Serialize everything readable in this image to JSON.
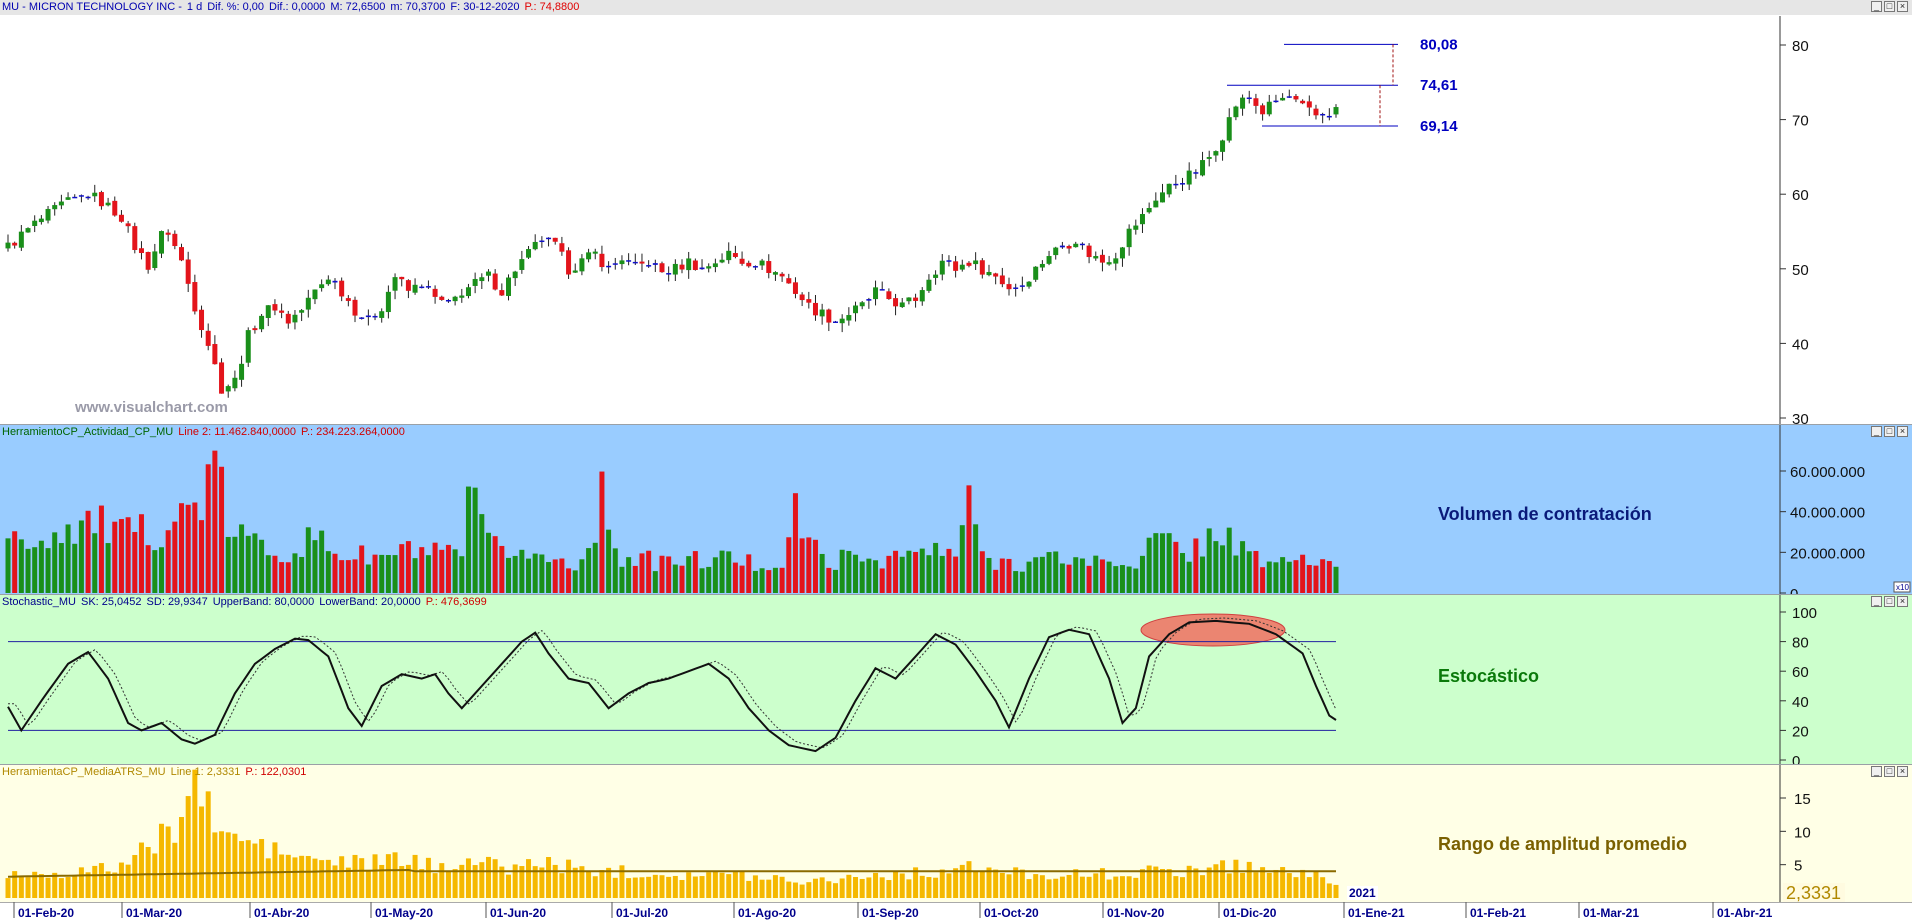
{
  "colors": {
    "up": "#1a8f1a",
    "down": "#e3141b",
    "doji": "#1010c8",
    "vol_bg": "#99ccff",
    "stoch_bg": "#ccffcc",
    "atr_bg": "#ffffe6",
    "atr_bar": "#f5b800",
    "level_line": "#0000c0"
  },
  "price_panel": {
    "header": {
      "symbol": "MU - MICRON TECHNOLOGY INC -",
      "timeframe": "1 d",
      "dif_pct": "Dif. %: 0,00",
      "dif": "Dif.: 0,0000",
      "max": "M: 72,6500",
      "min": "m: 70,3700",
      "date": "F: 30-12-2020",
      "price": "P.: 74,8800"
    },
    "watermark": "www.visualchart.com",
    "y_ticks": [
      "30",
      "40",
      "50",
      "60",
      "70",
      "80"
    ],
    "levels": [
      {
        "value": 80.08,
        "label": "80,08"
      },
      {
        "value": 74.61,
        "label": "74,61"
      },
      {
        "value": 69.14,
        "label": "69,14"
      }
    ]
  },
  "volume_panel": {
    "header": {
      "name": "HerramientoCP_Actividad_CP_MU",
      "line": "Line 2: 11.462.840,0000",
      "price": "P.: 234.223.264,0000"
    },
    "title": "Volumen de contratación",
    "y_ticks": [
      "0",
      "20.000.000",
      "40.000.000",
      "60.000.000"
    ],
    "scale_badge": "x10"
  },
  "stoch_panel": {
    "header": {
      "name": "Stochastic_MU",
      "sk": "SK: 25,0452",
      "sd": "SD: 29,9347",
      "upper": "UpperBand: 80,0000",
      "lower": "LowerBand: 20,0000",
      "price": "P.: 476,3699"
    },
    "title": "Estocástico",
    "y_ticks": [
      "0",
      "20",
      "40",
      "60",
      "80",
      "100"
    ]
  },
  "atr_panel": {
    "header": {
      "name": "HerramientaCP_MediaATRS_MU",
      "line": "Line 1: 2,3331",
      "price": "P.: 122,0301"
    },
    "title": "Rango de amplitud promedio",
    "y_ticks": [
      "5",
      "10",
      "15"
    ],
    "last_value": "2,3331"
  },
  "x_axis": {
    "labels": [
      "01-Feb-20",
      "01-Mar-20",
      "01-Abr-20",
      "01-May-20",
      "01-Jun-20",
      "01-Jul-20",
      "01-Ago-20",
      "01-Sep-20",
      "01-Oct-20",
      "01-Nov-20",
      "01-Dic-20",
      "01-Ene-21",
      "01-Feb-21",
      "01-Mar-21",
      "01-Abr-21"
    ],
    "year_marker": "2021"
  },
  "chart_data": {
    "type": "line",
    "title": "",
    "price_anchors": [
      [
        0,
        53
      ],
      [
        4,
        56
      ],
      [
        8,
        58.5
      ],
      [
        12,
        60
      ],
      [
        14,
        59
      ],
      [
        17,
        57
      ],
      [
        19,
        53
      ],
      [
        21,
        50.5
      ],
      [
        23,
        54.5
      ],
      [
        24,
        55
      ],
      [
        26,
        51
      ],
      [
        28,
        45
      ],
      [
        30,
        40
      ],
      [
        32,
        34
      ],
      [
        34,
        35
      ],
      [
        36,
        41
      ],
      [
        38,
        44
      ],
      [
        40,
        45
      ],
      [
        42,
        43
      ],
      [
        44,
        44.5
      ],
      [
        46,
        47
      ],
      [
        48,
        49
      ],
      [
        50,
        47
      ],
      [
        52,
        44.5
      ],
      [
        54,
        43
      ],
      [
        56,
        45
      ],
      [
        58,
        49
      ],
      [
        60,
        47
      ],
      [
        62,
        48
      ],
      [
        64,
        46
      ],
      [
        66,
        45
      ],
      [
        68,
        47
      ],
      [
        70,
        48
      ],
      [
        72,
        49
      ],
      [
        74,
        47
      ],
      [
        76,
        50
      ],
      [
        78,
        52
      ],
      [
        80,
        54
      ],
      [
        82,
        53
      ],
      [
        84,
        50
      ],
      [
        86,
        51
      ],
      [
        88,
        52
      ],
      [
        90,
        50
      ],
      [
        92,
        51.5
      ],
      [
        94,
        50
      ],
      [
        96,
        51
      ],
      [
        98,
        49.5
      ],
      [
        100,
        50
      ],
      [
        102,
        51
      ],
      [
        104,
        50
      ],
      [
        106,
        51
      ],
      [
        108,
        52
      ],
      [
        110,
        51
      ],
      [
        112,
        51
      ],
      [
        114,
        50
      ],
      [
        116,
        49
      ],
      [
        118,
        47
      ],
      [
        120,
        45
      ],
      [
        122,
        44
      ],
      [
        124,
        43
      ],
      [
        126,
        44
      ],
      [
        128,
        45
      ],
      [
        130,
        47
      ],
      [
        132,
        46
      ],
      [
        134,
        45
      ],
      [
        136,
        46
      ],
      [
        138,
        49
      ],
      [
        140,
        51
      ],
      [
        142,
        50
      ],
      [
        144,
        51
      ],
      [
        146,
        50
      ],
      [
        148,
        49
      ],
      [
        150,
        47.5
      ],
      [
        152,
        48
      ],
      [
        154,
        50
      ],
      [
        156,
        52
      ],
      [
        158,
        53
      ],
      [
        160,
        54
      ],
      [
        162,
        52
      ],
      [
        164,
        51
      ],
      [
        166,
        52
      ],
      [
        168,
        55
      ],
      [
        170,
        57
      ],
      [
        172,
        59.5
      ],
      [
        174,
        61
      ],
      [
        176,
        62
      ],
      [
        178,
        63
      ],
      [
        180,
        65
      ],
      [
        182,
        68
      ],
      [
        184,
        72
      ],
      [
        186,
        73
      ],
      [
        188,
        71
      ],
      [
        190,
        72.5
      ],
      [
        192,
        73
      ],
      [
        194,
        71.5
      ],
      [
        196,
        70.5
      ],
      [
        198,
        71
      ],
      [
        199,
        71.3
      ]
    ],
    "volume_anchors": [
      [
        0,
        25
      ],
      [
        6,
        30
      ],
      [
        12,
        38
      ],
      [
        17,
        30
      ],
      [
        22,
        32
      ],
      [
        26,
        40
      ],
      [
        28,
        45
      ],
      [
        30,
        55
      ],
      [
        31,
        65
      ],
      [
        33,
        35
      ],
      [
        37,
        25
      ],
      [
        42,
        22
      ],
      [
        46,
        28
      ],
      [
        50,
        20
      ],
      [
        56,
        18
      ],
      [
        60,
        22
      ],
      [
        64,
        20
      ],
      [
        68,
        18
      ],
      [
        69,
        52
      ],
      [
        72,
        24
      ],
      [
        76,
        22
      ],
      [
        80,
        18
      ],
      [
        86,
        16
      ],
      [
        89,
        48
      ],
      [
        92,
        18
      ],
      [
        98,
        16
      ],
      [
        104,
        17
      ],
      [
        108,
        18
      ],
      [
        112,
        15
      ],
      [
        116,
        16
      ],
      [
        118,
        40
      ],
      [
        122,
        17
      ],
      [
        128,
        18
      ],
      [
        134,
        19
      ],
      [
        138,
        22
      ],
      [
        142,
        18
      ],
      [
        144,
        55
      ],
      [
        146,
        17
      ],
      [
        152,
        16
      ],
      [
        158,
        18
      ],
      [
        164,
        16
      ],
      [
        170,
        17
      ],
      [
        172,
        30
      ],
      [
        176,
        20
      ],
      [
        180,
        28
      ],
      [
        182,
        33
      ],
      [
        186,
        18
      ],
      [
        190,
        16
      ],
      [
        194,
        18
      ],
      [
        199,
        12
      ]
    ],
    "stoch_anchors": [
      [
        0,
        36
      ],
      [
        2,
        20
      ],
      [
        5,
        40
      ],
      [
        9,
        65
      ],
      [
        12,
        73
      ],
      [
        15,
        55
      ],
      [
        18,
        25
      ],
      [
        20,
        20
      ],
      [
        23,
        25
      ],
      [
        26,
        14
      ],
      [
        28,
        11
      ],
      [
        31,
        17
      ],
      [
        34,
        45
      ],
      [
        37,
        65
      ],
      [
        40,
        75
      ],
      [
        43,
        82
      ],
      [
        45,
        81
      ],
      [
        48,
        70
      ],
      [
        51,
        35
      ],
      [
        53,
        23
      ],
      [
        56,
        50
      ],
      [
        59,
        58
      ],
      [
        62,
        55
      ],
      [
        64,
        58
      ],
      [
        66,
        45
      ],
      [
        68,
        35
      ],
      [
        71,
        50
      ],
      [
        74,
        65
      ],
      [
        77,
        80
      ],
      [
        79,
        86
      ],
      [
        81,
        72
      ],
      [
        84,
        55
      ],
      [
        87,
        52
      ],
      [
        90,
        35
      ],
      [
        93,
        45
      ],
      [
        96,
        52
      ],
      [
        99,
        55
      ],
      [
        102,
        60
      ],
      [
        105,
        65
      ],
      [
        108,
        55
      ],
      [
        111,
        35
      ],
      [
        114,
        20
      ],
      [
        117,
        10
      ],
      [
        121,
        6
      ],
      [
        124,
        15
      ],
      [
        127,
        40
      ],
      [
        130,
        62
      ],
      [
        133,
        55
      ],
      [
        136,
        70
      ],
      [
        139,
        85
      ],
      [
        142,
        78
      ],
      [
        145,
        60
      ],
      [
        148,
        40
      ],
      [
        150,
        22
      ],
      [
        153,
        55
      ],
      [
        156,
        83
      ],
      [
        159,
        88
      ],
      [
        162,
        85
      ],
      [
        165,
        55
      ],
      [
        167,
        25
      ],
      [
        169,
        35
      ],
      [
        171,
        70
      ],
      [
        174,
        85
      ],
      [
        177,
        93
      ],
      [
        181,
        94
      ],
      [
        186,
        92
      ],
      [
        190,
        85
      ],
      [
        194,
        72
      ],
      [
        196,
        50
      ],
      [
        198,
        30
      ],
      [
        199,
        27
      ]
    ],
    "atr_anchors": [
      [
        0,
        3.5
      ],
      [
        8,
        3.8
      ],
      [
        14,
        4.2
      ],
      [
        18,
        5.5
      ],
      [
        22,
        8
      ],
      [
        25,
        11
      ],
      [
        27,
        15
      ],
      [
        28,
        17.5
      ],
      [
        30,
        13
      ],
      [
        33,
        9
      ],
      [
        36,
        8.5
      ],
      [
        40,
        7
      ],
      [
        44,
        6
      ],
      [
        48,
        5.5
      ],
      [
        52,
        5.2
      ],
      [
        56,
        5.5
      ],
      [
        60,
        5.8
      ],
      [
        64,
        4.5
      ],
      [
        68,
        6
      ],
      [
        72,
        5
      ],
      [
        76,
        4.5
      ],
      [
        80,
        5.5
      ],
      [
        86,
        4.2
      ],
      [
        92,
        4
      ],
      [
        100,
        3.6
      ],
      [
        108,
        3.5
      ],
      [
        116,
        3
      ],
      [
        120,
        2.5
      ],
      [
        126,
        3.2
      ],
      [
        132,
        3.5
      ],
      [
        138,
        3.8
      ],
      [
        144,
        4.5
      ],
      [
        150,
        3.8
      ],
      [
        156,
        3.6
      ],
      [
        162,
        3.5
      ],
      [
        168,
        3.8
      ],
      [
        174,
        4
      ],
      [
        180,
        4.5
      ],
      [
        184,
        5
      ],
      [
        190,
        4.2
      ],
      [
        196,
        3.2
      ],
      [
        199,
        2.6
      ]
    ]
  }
}
